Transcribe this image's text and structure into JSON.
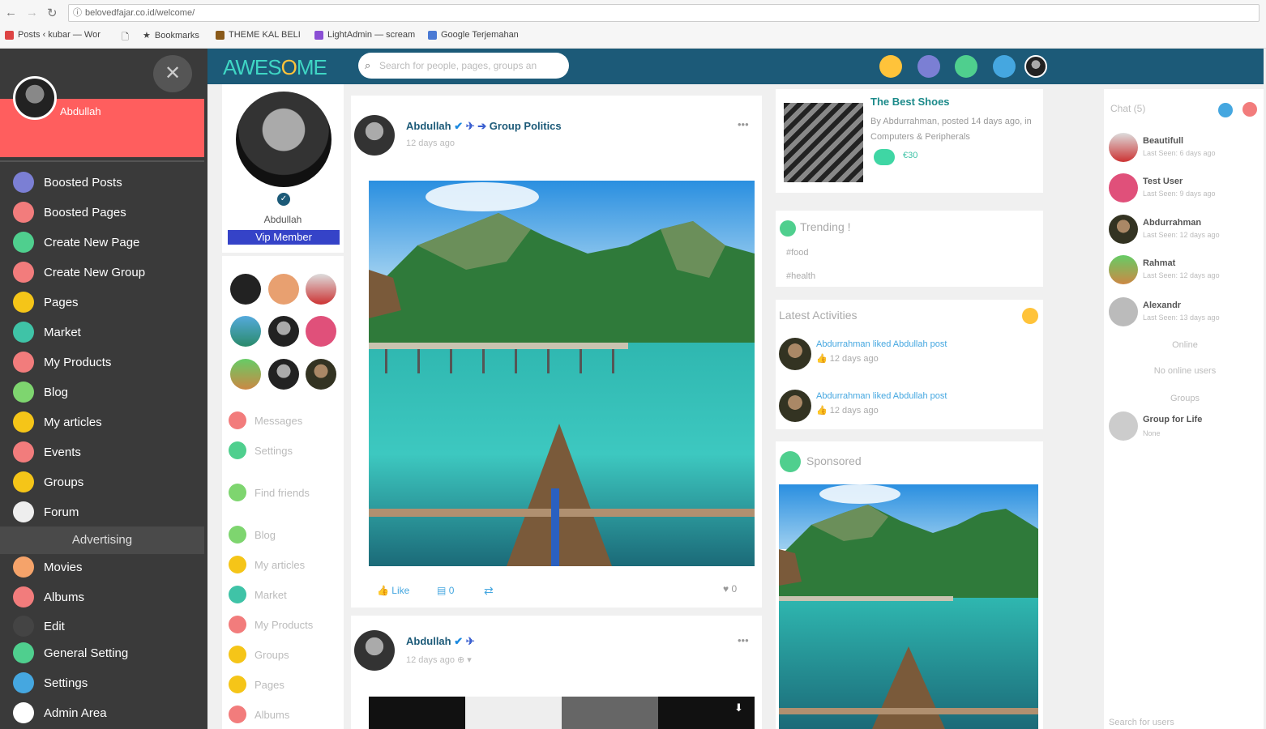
{
  "browser": {
    "url": "belovedfajar.co.id/welcome/",
    "bookmarks": [
      "Posts ‹ kubar — Wor",
      "Bookmarks",
      "THEME KAL BELI",
      "LightAdmin — scream",
      "Google Terjemahan"
    ]
  },
  "sidebar": {
    "user_name": "Abdullah",
    "close_label": "✕",
    "items": [
      {
        "label": "Boosted Posts",
        "color": "#7b7fd4"
      },
      {
        "label": "Boosted Pages",
        "color": "#f27c7c"
      },
      {
        "label": "Create New Page",
        "color": "#4fcf8e"
      },
      {
        "label": "Create New Group",
        "color": "#f27c7c"
      },
      {
        "label": "Pages",
        "color": "#f5c518"
      },
      {
        "label": "Market",
        "color": "#3fc3a7"
      },
      {
        "label": "My Products",
        "color": "#f27c7c"
      },
      {
        "label": "Blog",
        "color": "#7ed56f"
      },
      {
        "label": "My articles",
        "color": "#f5c518"
      },
      {
        "label": "Events",
        "color": "#f27c7c"
      },
      {
        "label": "Groups",
        "color": "#f5c518"
      },
      {
        "label": "Forum",
        "color": "#eeeeee"
      }
    ],
    "section": "Advertising",
    "items2": [
      {
        "label": "Movies",
        "color": "#f5a36a"
      },
      {
        "label": "Albums",
        "color": "#f27c7c"
      },
      {
        "label": "Edit",
        "color": "#444444"
      },
      {
        "label": "General Setting",
        "color": "#4fcf8e"
      },
      {
        "label": "Settings",
        "color": "#45a7e0"
      },
      {
        "label": "Admin Area",
        "color": "#ffffff"
      }
    ]
  },
  "header": {
    "logo_left": "AWES",
    "logo_o": "O",
    "logo_right": "ME",
    "search_placeholder": "Search for people, pages, groups an"
  },
  "profile": {
    "name": "Abdullah",
    "badge": "Vip Member",
    "links": [
      {
        "label": "Messages",
        "color": "#f27c7c"
      },
      {
        "label": "Settings",
        "color": "#4fcf8e"
      },
      {
        "label": "Find friends",
        "color": "#7ed56f"
      },
      {
        "label": "Blog",
        "color": "#7ed56f"
      },
      {
        "label": "My articles",
        "color": "#f5c518"
      },
      {
        "label": "Market",
        "color": "#3fc3a7"
      },
      {
        "label": "My Products",
        "color": "#f27c7c"
      },
      {
        "label": "Groups",
        "color": "#f5c518"
      },
      {
        "label": "Pages",
        "color": "#f5c518"
      },
      {
        "label": "Albums",
        "color": "#f27c7c"
      }
    ]
  },
  "feed": {
    "post1": {
      "author": "Abdullah",
      "target": "Group Politics",
      "time": "12 days ago",
      "like": "Like",
      "comments": "0",
      "hearts": "0"
    },
    "post2": {
      "author": "Abdullah",
      "time": "12 days ago"
    }
  },
  "right": {
    "product": {
      "title": "The Best Shoes",
      "meta": "By Abdurrahman, posted 14 days ago, in Computers & Peripherals",
      "price": "€30"
    },
    "trending_title": "Trending !",
    "trending": [
      "#food",
      "#health"
    ],
    "activities_title": "Latest Activities",
    "activities": [
      {
        "text": "Abdurrahman liked Abdullah post",
        "time": "12 days ago"
      },
      {
        "text": "Abdurrahman liked Abdullah post",
        "time": "12 days ago"
      }
    ],
    "sponsored": "Sponsored"
  },
  "chat": {
    "title": "Chat (5)",
    "users": [
      {
        "name": "Beautifull",
        "seen": "Last Seen: 6 days ago"
      },
      {
        "name": "Test User",
        "seen": "Last Seen: 9 days ago"
      },
      {
        "name": "Abdurrahman",
        "seen": "Last Seen: 12 days ago"
      },
      {
        "name": "Rahmat",
        "seen": "Last Seen: 12 days ago"
      },
      {
        "name": "Alexandr",
        "seen": "Last Seen: 13 days ago"
      }
    ],
    "online_title": "Online",
    "no_online": "No online users",
    "groups_title": "Groups",
    "group": {
      "name": "Group for Life",
      "sub": "None"
    },
    "search_placeholder": "Search for users"
  }
}
